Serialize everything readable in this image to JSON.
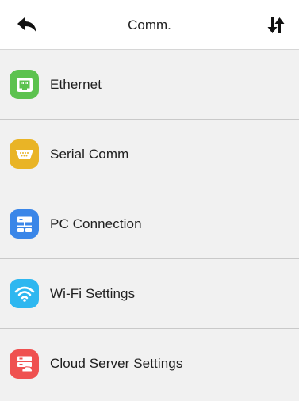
{
  "header": {
    "title": "Comm.",
    "back_icon": "back-arrow-icon",
    "sort_icon": "sort-arrows-icon"
  },
  "menu": {
    "items": [
      {
        "label": "Ethernet",
        "icon": "ethernet-port-icon",
        "color": "#5cc24f"
      },
      {
        "label": "Serial Comm",
        "icon": "serial-port-icon",
        "color": "#e9b426"
      },
      {
        "label": "PC Connection",
        "icon": "network-connection-icon",
        "color": "#3a86e8"
      },
      {
        "label": "Wi-Fi Settings",
        "icon": "wifi-icon",
        "color": "#2eb7f0"
      },
      {
        "label": "Cloud Server Settings",
        "icon": "cloud-server-icon",
        "color": "#ef5150"
      }
    ]
  }
}
